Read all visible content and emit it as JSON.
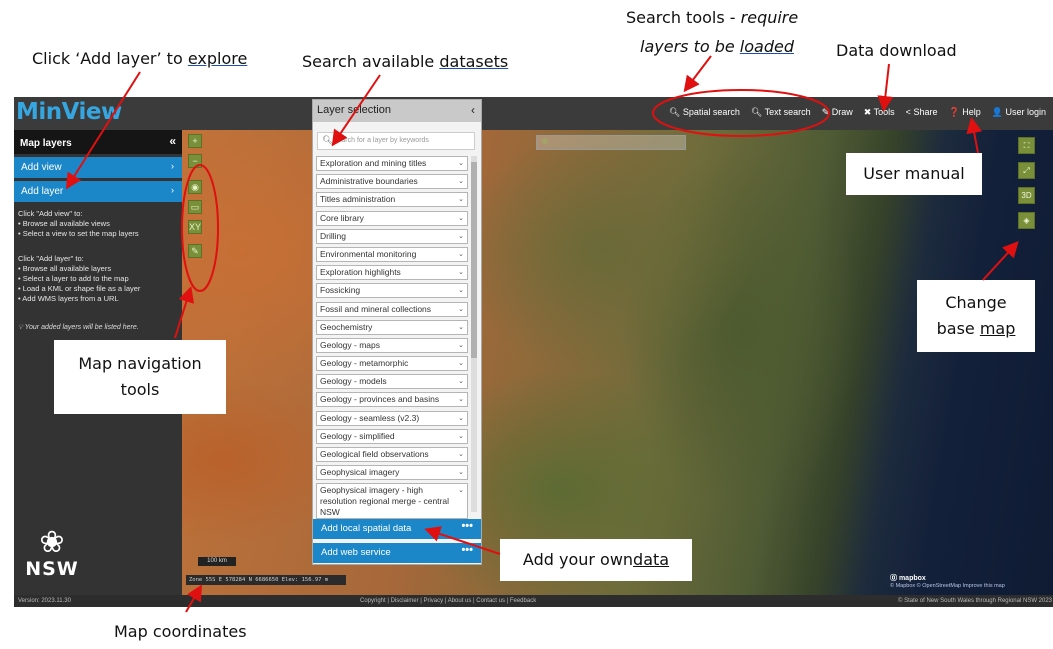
{
  "annotations": {
    "add_layer": {
      "prefix": "Click ‘Add layer’ to ",
      "link": "explore"
    },
    "search_datasets": {
      "prefix": "Search available ",
      "link": "datasets"
    },
    "search_tools_line1_plain": "Search tools - ",
    "search_tools_line1_italic": "require",
    "search_tools_line2_prefix": "layers to be ",
    "search_tools_line2_link": "loaded",
    "data_download": "Data download",
    "user_manual": "User manual",
    "change_base_line1": "Change",
    "change_base_line2_prefix": "base ",
    "change_base_line2_link": "map",
    "map_nav_line1": "Map navigation",
    "map_nav_line2": "tools",
    "add_own_prefix": "Add your own ",
    "add_own_link": "data",
    "map_coords": "Map coordinates"
  },
  "app": {
    "logo": "MinView",
    "toolbar": [
      {
        "icon": "magnifier-icon",
        "glyph": "🔍︎",
        "label": "Spatial search"
      },
      {
        "icon": "search-icon",
        "glyph": "🔍︎",
        "label": "Text search"
      },
      {
        "icon": "draw-icon",
        "glyph": "✎",
        "label": "Draw"
      },
      {
        "icon": "tools-icon",
        "glyph": "✖",
        "label": "Tools"
      },
      {
        "icon": "share-icon",
        "glyph": "<",
        "label": "Share"
      },
      {
        "icon": "help-icon",
        "glyph": "❓",
        "label": "Help"
      },
      {
        "icon": "user-icon",
        "glyph": "👤",
        "label": "User login"
      }
    ]
  },
  "sidebar": {
    "title": "Map layers",
    "collapse_glyph": "«",
    "add_view": "Add view",
    "add_layer": "Add layer",
    "chevron": "›",
    "view_help_title": "Click \"Add view\" to:",
    "view_help": [
      "Browse all available views",
      "Select a view to set the map layers"
    ],
    "layer_help_title": "Click \"Add layer\" to:",
    "layer_help": [
      "Browse all available layers",
      "Select a layer to add to the map",
      "Load a KML or shape file as a layer",
      "Add WMS layers from a URL"
    ],
    "note": "Your added layers will be listed here.",
    "nsw_label": "NSW"
  },
  "panel": {
    "title": "Layer selection",
    "collapse_glyph": "‹",
    "search_placeholder": "search for a layer by keywords",
    "layers": [
      "Exploration and mining titles",
      "Administrative boundaries",
      "Titles administration",
      "Core library",
      "Drilling",
      "Environmental monitoring",
      "Exploration highlights",
      "Fossicking",
      "Fossil and mineral collections",
      "Geochemistry",
      "Geology - maps",
      "Geology - metamorphic",
      "Geology - models",
      "Geology - provinces and basins",
      "Geology - seamless (v2.3)",
      "Geology - simplified",
      "Geological field observations",
      "Geophysical imagery"
    ],
    "last_layer": "Geophysical imagery - high resolution regional merge - central NSW",
    "add_local": "Add local spatial data",
    "add_web": "Add web service",
    "dots": "•••"
  },
  "map": {
    "tools": [
      "+",
      "−",
      "◉",
      "▭",
      "XY",
      "✎"
    ],
    "right_tools": [
      "⛶",
      "⤢",
      "3D",
      "◈"
    ],
    "scale": "100 km",
    "coords": "Zone 55S E 578284 N 6686650 Elev: 156.97 m",
    "mapbox": "mapbox",
    "mapbox_attr": "© Mapbox © OpenStreetMap Improve this map"
  },
  "footer": {
    "version": "Version: 2023.11.30",
    "links": "Copyright  |  Disclaimer  |  Privacy  |  About us  |  Contact us  |  Feedback",
    "copyright": "© State of New South Wales through Regional NSW 2023"
  }
}
